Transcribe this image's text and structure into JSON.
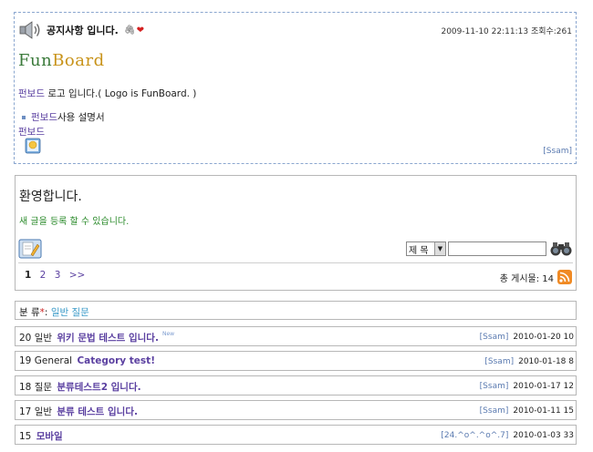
{
  "notice": {
    "title": "공지사항 입니다.",
    "clip_glyph": "🖇",
    "heart_glyph": "❤",
    "datetime": "2009-11-10 22:11:13",
    "views": "조회수:261",
    "logo_part1": "Fun",
    "logo_part2": "Board",
    "logo_link": "펀보드",
    "logo_text": " 로고 입니다.( Logo is FunBoard. )",
    "manual_link": "펀보드",
    "manual_text": " 사용 설명서",
    "funboard_link": "펀보드",
    "author": "[Ssam]"
  },
  "welcome": {
    "title": "환영합니다.",
    "subtitle": "새 글을 등록 할 수 있습니다."
  },
  "search": {
    "field_selected": "제 목",
    "query": ""
  },
  "pagination": {
    "pages": [
      "1",
      "2",
      "3",
      ">>"
    ],
    "current": "1"
  },
  "total": {
    "label": "총 게시물: 14"
  },
  "category": {
    "label": "분 류",
    "star": "*",
    "colon": ": ",
    "value": "일반 질문"
  },
  "posts": [
    {
      "num": "20",
      "cat": "일반",
      "title": "위키 문법 테스트 입니다.",
      "newtag": "New",
      "author": "[Ssam]",
      "date": "2010-01-20 10"
    },
    {
      "num": "19",
      "cat": "General",
      "title": "Category test!",
      "newtag": "",
      "author": "[Ssam]",
      "date": "2010-01-18 8"
    },
    {
      "num": "18",
      "cat": "질문",
      "title": "분류테스트2 입니다.",
      "newtag": "",
      "author": "[Ssam]",
      "date": "2010-01-17 12"
    },
    {
      "num": "17",
      "cat": "일반",
      "title": "분류 테스트 입니다.",
      "newtag": "",
      "author": "[Ssam]",
      "date": "2010-01-11 15"
    },
    {
      "num": "15",
      "cat": "",
      "title": "모바일",
      "newtag": "",
      "author": "[24.^o^.^o^.7]",
      "date": "2010-01-03 33"
    }
  ],
  "colors": {
    "link_purple": "#5a3fa0",
    "notice_border": "#8aa6cf",
    "welcome_green": "#2a8a2a",
    "rss_orange": "#f08a24"
  },
  "icons": [
    "speaker-icon",
    "paperclip-icon",
    "heart-icon",
    "image-icon",
    "write-icon",
    "binoculars-icon",
    "rss-icon"
  ]
}
